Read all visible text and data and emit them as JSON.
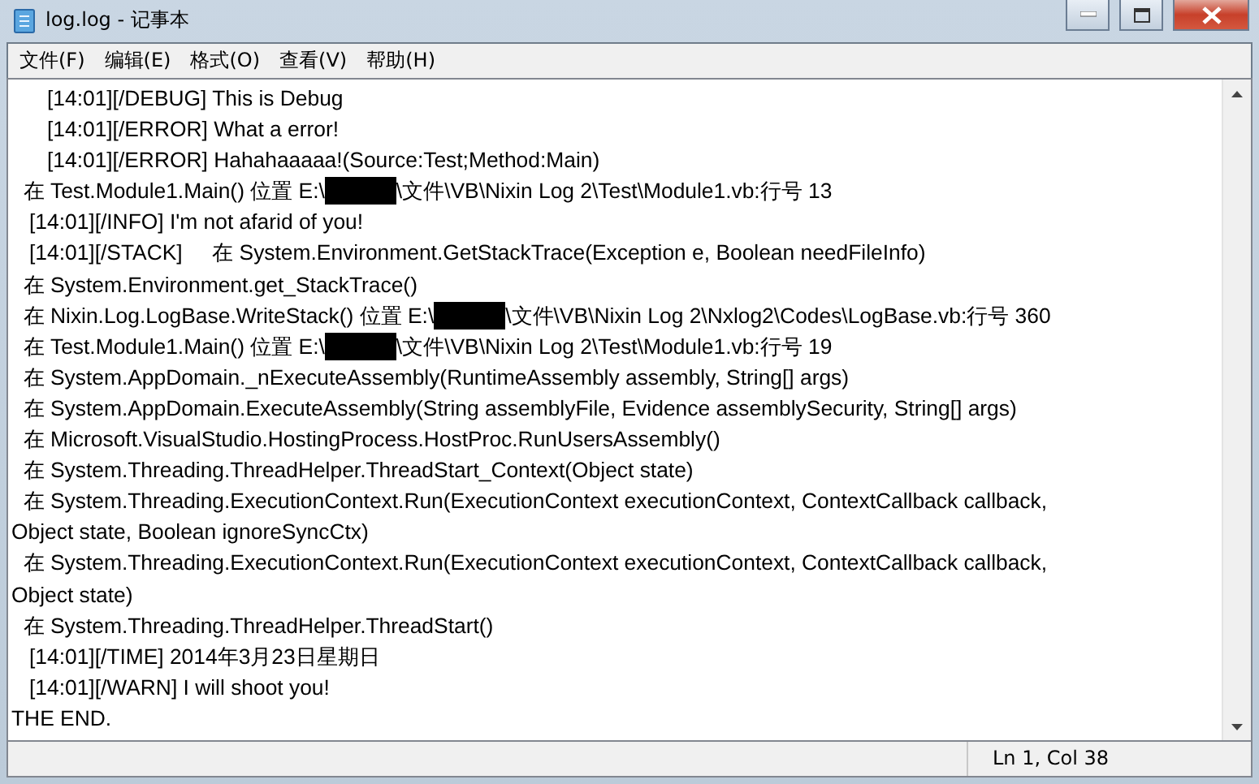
{
  "window": {
    "title": "log.log - 记事本"
  },
  "menu": [
    "文件(F)",
    "编辑(E)",
    "格式(O)",
    "查看(V)",
    "帮助(H)"
  ],
  "lines": [
    {
      "parts": [
        "      [14:01][/DEBUG] This is Debug"
      ]
    },
    {
      "parts": [
        "      [14:01][/ERROR] What a error!"
      ]
    },
    {
      "parts": [
        "      [14:01][/ERROR] Hahahaaaaa!(Source:Test;Method:Main)"
      ]
    },
    {
      "parts": [
        "  在 Test.Module1.Main() 位置 E:\\",
        "\\文件\\VB\\Nixin Log 2\\Test\\Module1.vb:行号 13"
      ]
    },
    {
      "parts": [
        "   [14:01][/INFO] I'm not afarid of you!"
      ]
    },
    {
      "parts": [
        "   [14:01][/STACK]     在 System.Environment.GetStackTrace(Exception e, Boolean needFileInfo)"
      ]
    },
    {
      "parts": [
        "  在 System.Environment.get_StackTrace()"
      ]
    },
    {
      "parts": [
        "  在 Nixin.Log.LogBase.WriteStack() 位置 E:\\",
        "\\文件\\VB\\Nixin Log 2\\Nxlog2\\Codes\\LogBase.vb:行号 360"
      ]
    },
    {
      "parts": [
        "  在 Test.Module1.Main() 位置 E:\\",
        "\\文件\\VB\\Nixin Log 2\\Test\\Module1.vb:行号 19"
      ]
    },
    {
      "parts": [
        "  在 System.AppDomain._nExecuteAssembly(RuntimeAssembly assembly, String[] args)"
      ]
    },
    {
      "parts": [
        "  在 System.AppDomain.ExecuteAssembly(String assemblyFile, Evidence assemblySecurity, String[] args)"
      ]
    },
    {
      "parts": [
        "  在 Microsoft.VisualStudio.HostingProcess.HostProc.RunUsersAssembly()"
      ]
    },
    {
      "parts": [
        "  在 System.Threading.ThreadHelper.ThreadStart_Context(Object state)"
      ]
    },
    {
      "parts": [
        "  在 System.Threading.ExecutionContext.Run(ExecutionContext executionContext, ContextCallback callback,"
      ]
    },
    {
      "parts": [
        "Object state, Boolean ignoreSyncCtx)"
      ]
    },
    {
      "parts": [
        "  在 System.Threading.ExecutionContext.Run(ExecutionContext executionContext, ContextCallback callback,"
      ]
    },
    {
      "parts": [
        "Object state)"
      ]
    },
    {
      "parts": [
        "  在 System.Threading.ThreadHelper.ThreadStart()"
      ]
    },
    {
      "parts": [
        "   [14:01][/TIME] 2014年3月23日星期日"
      ]
    },
    {
      "parts": [
        "   [14:01][/WARN] I will shoot you!"
      ]
    },
    {
      "parts": [
        "THE END."
      ]
    }
  ],
  "status_bar": {
    "position": "Ln 1, Col 38"
  }
}
